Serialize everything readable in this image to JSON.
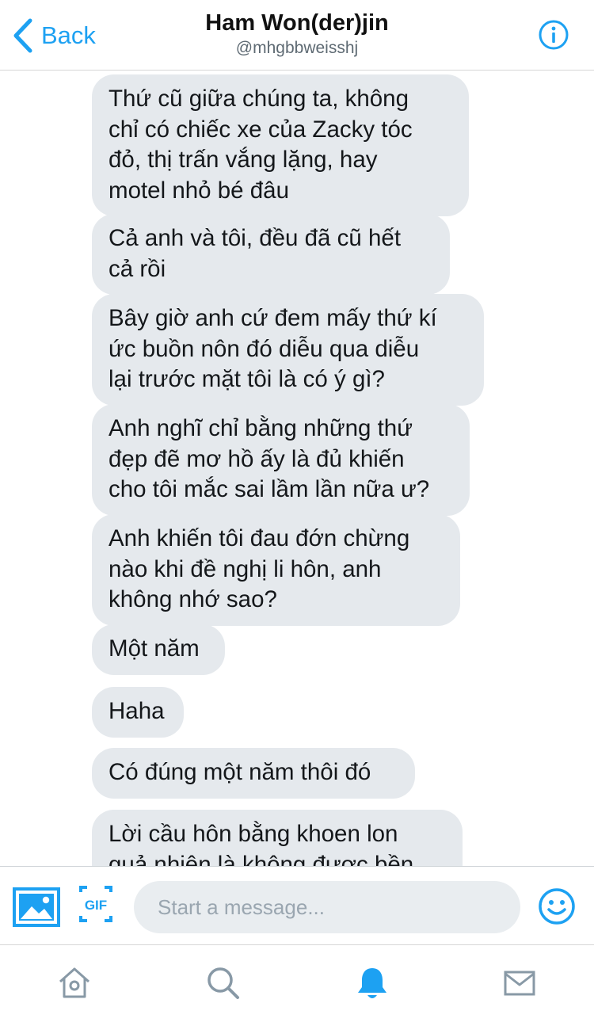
{
  "header": {
    "back_label": "Back",
    "title": "Ham Won(der)jin",
    "handle": "@mhgbbweisshj",
    "info_icon": "info-icon"
  },
  "messages": [
    {
      "lines": [
        "Thứ cũ giữa chúng ta, không",
        "chỉ có chiếc xe của Zacky tóc",
        "đỏ, thị trấn vắng lặng, hay",
        "motel nhỏ bé đâu"
      ]
    },
    {
      "lines": [
        "Cả anh và tôi, đều đã cũ hết",
        "cả rồi"
      ]
    },
    {
      "lines": [
        "Bây giờ anh cứ đem mấy thứ kí",
        "ức buồn nôn đó diễu qua diễu",
        "lại trước mặt tôi là có ý gì?"
      ]
    },
    {
      "lines": [
        "Anh nghĩ chỉ bằng những thứ",
        "đẹp đẽ mơ hồ ấy là đủ khiến",
        "cho tôi mắc sai lầm lần nữa ư?"
      ]
    },
    {
      "lines": [
        "Anh khiến tôi đau đớn chừng",
        "nào khi đề nghị li hôn, anh",
        "không nhớ sao?"
      ]
    },
    {
      "lines": [
        "Một năm"
      ]
    },
    {
      "lines": [
        "Haha"
      ]
    },
    {
      "lines": [
        "Có đúng một năm thôi đó"
      ]
    },
    {
      "lines": [
        "Lời cầu hôn bằng khoen lon",
        "quả nhiên là không được bền"
      ]
    }
  ],
  "composer": {
    "placeholder": "Start a message...",
    "gif_label": "GIF"
  },
  "tabbar": {
    "tabs": [
      {
        "name": "home",
        "icon": "home-icon",
        "active": false
      },
      {
        "name": "search",
        "icon": "search-icon",
        "active": false
      },
      {
        "name": "notifications",
        "icon": "bell-icon",
        "active": true
      },
      {
        "name": "messages",
        "icon": "mail-icon",
        "active": false
      }
    ]
  },
  "colors": {
    "accent": "#1da1f2",
    "bubble": "#e5e9ed",
    "inactive_icon": "#8899a6"
  }
}
